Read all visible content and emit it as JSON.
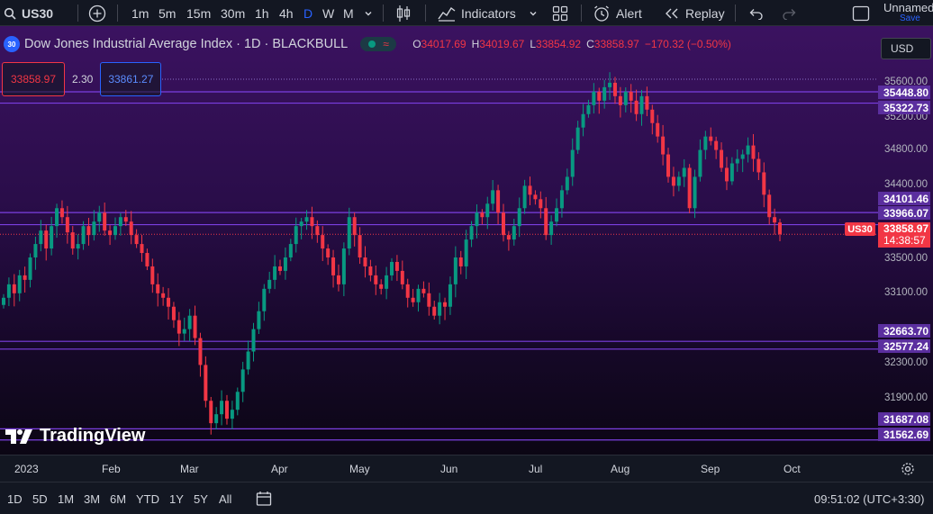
{
  "toolbar": {
    "symbol": "US30",
    "timeframes": [
      "1m",
      "5m",
      "15m",
      "30m",
      "1h",
      "4h",
      "D",
      "W",
      "M"
    ],
    "active_timeframe": "D",
    "indicators_label": "Indicators",
    "alert_label": "Alert",
    "replay_label": "Replay",
    "layout_name": "Unnamed",
    "save_label": "Save"
  },
  "legend": {
    "badge": "30",
    "title": "Dow Jones Industrial Average Index · 1D · BLACKBULL",
    "open_key": "O",
    "open": "34017.69",
    "high_key": "H",
    "high": "34019.67",
    "low_key": "L",
    "low": "33854.92",
    "close_key": "C",
    "close": "33858.97",
    "change": "−170.32 (−0.50%)",
    "currency": "USD"
  },
  "bidask": {
    "bid": "33858.97",
    "spread": "2.30",
    "ask": "33861.27"
  },
  "price_axis": {
    "ticks": [
      "35600.00",
      "35200.00",
      "34800.00",
      "34400.00",
      "33500.00",
      "33100.00",
      "32300.00",
      "31900.00"
    ],
    "horizontal_lines": [
      "35448.80",
      "35322.73",
      "34101.46",
      "33966.07",
      "32663.70",
      "32577.24",
      "31687.08",
      "31562.69"
    ],
    "last_price": "33858.97",
    "countdown": "14:38:57",
    "symbol_tag": "US30"
  },
  "time_axis": {
    "labels": [
      "2023",
      "Feb",
      "Mar",
      "Apr",
      "May",
      "Jun",
      "Jul",
      "Aug",
      "Sep",
      "Oct"
    ]
  },
  "branding": {
    "logo_text": "TradingView"
  },
  "bottombar": {
    "ranges": [
      "1D",
      "5D",
      "1M",
      "3M",
      "6M",
      "YTD",
      "1Y",
      "5Y",
      "All"
    ],
    "clock": "09:51:02 (UTC+3:30)"
  },
  "colors": {
    "up": "#089981",
    "down": "#f23645",
    "accent": "#2962ff",
    "hline": "#7b3fe0"
  },
  "chart_data": {
    "type": "candlestick",
    "x_labels": [
      "2023",
      "Feb",
      "Mar",
      "Apr",
      "May",
      "Jun",
      "Jul",
      "Aug",
      "Sep",
      "Oct"
    ],
    "ylim": [
      31500,
      35700
    ],
    "closes": [
      33150,
      33300,
      33200,
      33400,
      33350,
      33600,
      33750,
      33900,
      33700,
      33950,
      34150,
      34050,
      33880,
      33700,
      33750,
      33950,
      33850,
      34000,
      34100,
      33900,
      33850,
      33950,
      34050,
      34000,
      33850,
      33750,
      33650,
      33500,
      33300,
      33200,
      33150,
      33050,
      32900,
      32750,
      32800,
      32950,
      32700,
      32400,
      32000,
      31750,
      31850,
      32000,
      31800,
      31900,
      32100,
      32350,
      32550,
      32800,
      33000,
      33250,
      33350,
      33500,
      33450,
      33600,
      33750,
      33950,
      34000,
      34050,
      33950,
      33850,
      33700,
      33600,
      33400,
      33300,
      33700,
      34050,
      33850,
      33600,
      33500,
      33400,
      33300,
      33250,
      33400,
      33550,
      33450,
      33300,
      33150,
      33100,
      33250,
      33200,
      33050,
      32950,
      33100,
      33050,
      33300,
      33600,
      33500,
      33800,
      33950,
      34100,
      34050,
      34200,
      34350,
      34100,
      33850,
      33800,
      33950,
      34150,
      34400,
      34300,
      34250,
      34150,
      33850,
      34000,
      34150,
      34350,
      34500,
      34800,
      35050,
      35200,
      35300,
      35450,
      35350,
      35500,
      35550,
      35400,
      35300,
      35450,
      35350,
      35200,
      35400,
      35250,
      35100,
      34950,
      34750,
      34500,
      34400,
      34500,
      34600,
      34150,
      34500,
      34800,
      34950,
      34900,
      34800,
      34600,
      34450,
      34650,
      34700,
      34750,
      34850,
      34700,
      34550,
      34300,
      34050,
      33990,
      33858.97
    ]
  }
}
